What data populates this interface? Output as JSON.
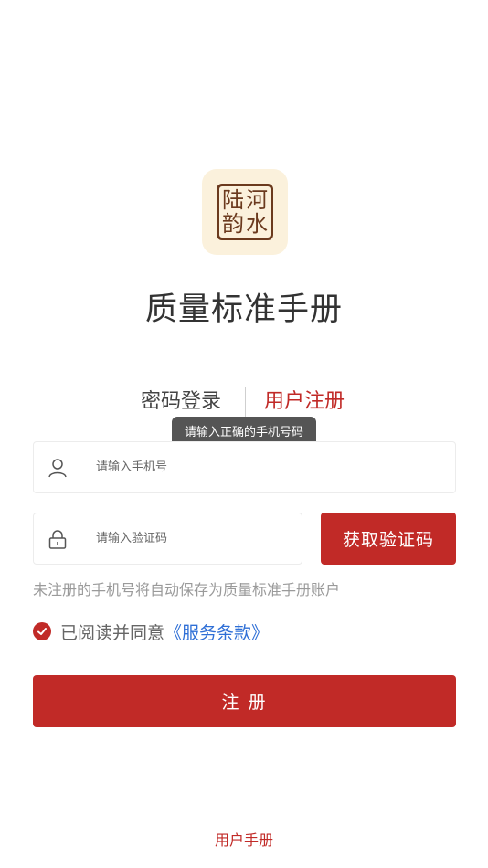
{
  "logo": {
    "seal_chars": [
      "河",
      "陆",
      "水",
      "韵"
    ]
  },
  "app": {
    "title": "质量标准手册"
  },
  "tabs": {
    "password_login": "密码登录",
    "register": "用户注册"
  },
  "tooltip": {
    "text": "请输入正确的手机号码"
  },
  "form": {
    "phone_placeholder": "请输入手机号",
    "code_placeholder": "请输入验证码",
    "get_code_label": "获取验证码"
  },
  "hint": {
    "text": "未注册的手机号将自动保存为质量标准手册账户"
  },
  "agreement": {
    "prefix": "已阅读并同意",
    "terms": "《服务条款》",
    "checked": true
  },
  "submit": {
    "label": "注 册"
  },
  "footer": {
    "manual_link": "用户手册"
  },
  "colors": {
    "accent": "#c12a27",
    "link": "#2f6fd6",
    "tooltip_bg": "#555555",
    "logo_bg": "#fbf1dc"
  },
  "icons": {
    "phone_field": "user-icon",
    "code_field": "lock-icon",
    "agreement": "check-icon"
  }
}
